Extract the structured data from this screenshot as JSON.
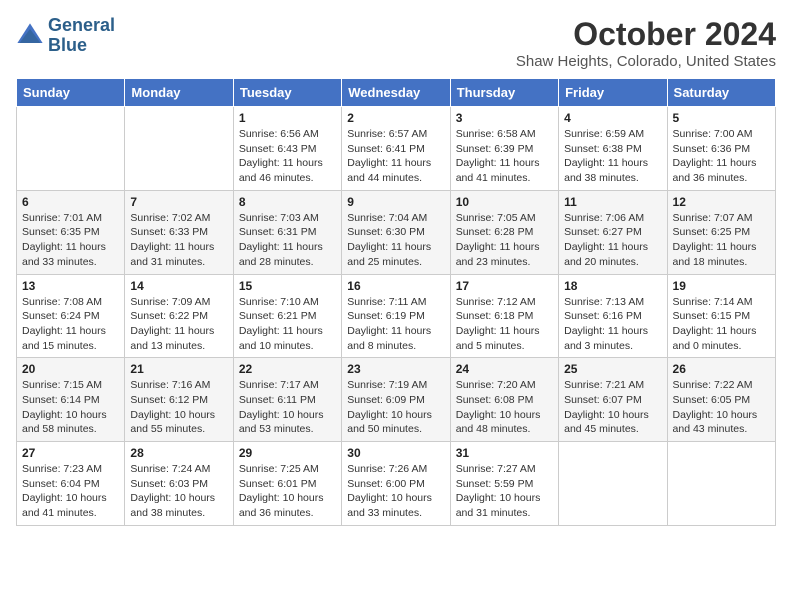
{
  "header": {
    "logo_line1": "General",
    "logo_line2": "Blue",
    "month_title": "October 2024",
    "location": "Shaw Heights, Colorado, United States"
  },
  "weekdays": [
    "Sunday",
    "Monday",
    "Tuesday",
    "Wednesday",
    "Thursday",
    "Friday",
    "Saturday"
  ],
  "weeks": [
    [
      {
        "day": "",
        "sunrise": "",
        "sunset": "",
        "daylight": ""
      },
      {
        "day": "",
        "sunrise": "",
        "sunset": "",
        "daylight": ""
      },
      {
        "day": "1",
        "sunrise": "Sunrise: 6:56 AM",
        "sunset": "Sunset: 6:43 PM",
        "daylight": "Daylight: 11 hours and 46 minutes."
      },
      {
        "day": "2",
        "sunrise": "Sunrise: 6:57 AM",
        "sunset": "Sunset: 6:41 PM",
        "daylight": "Daylight: 11 hours and 44 minutes."
      },
      {
        "day": "3",
        "sunrise": "Sunrise: 6:58 AM",
        "sunset": "Sunset: 6:39 PM",
        "daylight": "Daylight: 11 hours and 41 minutes."
      },
      {
        "day": "4",
        "sunrise": "Sunrise: 6:59 AM",
        "sunset": "Sunset: 6:38 PM",
        "daylight": "Daylight: 11 hours and 38 minutes."
      },
      {
        "day": "5",
        "sunrise": "Sunrise: 7:00 AM",
        "sunset": "Sunset: 6:36 PM",
        "daylight": "Daylight: 11 hours and 36 minutes."
      }
    ],
    [
      {
        "day": "6",
        "sunrise": "Sunrise: 7:01 AM",
        "sunset": "Sunset: 6:35 PM",
        "daylight": "Daylight: 11 hours and 33 minutes."
      },
      {
        "day": "7",
        "sunrise": "Sunrise: 7:02 AM",
        "sunset": "Sunset: 6:33 PM",
        "daylight": "Daylight: 11 hours and 31 minutes."
      },
      {
        "day": "8",
        "sunrise": "Sunrise: 7:03 AM",
        "sunset": "Sunset: 6:31 PM",
        "daylight": "Daylight: 11 hours and 28 minutes."
      },
      {
        "day": "9",
        "sunrise": "Sunrise: 7:04 AM",
        "sunset": "Sunset: 6:30 PM",
        "daylight": "Daylight: 11 hours and 25 minutes."
      },
      {
        "day": "10",
        "sunrise": "Sunrise: 7:05 AM",
        "sunset": "Sunset: 6:28 PM",
        "daylight": "Daylight: 11 hours and 23 minutes."
      },
      {
        "day": "11",
        "sunrise": "Sunrise: 7:06 AM",
        "sunset": "Sunset: 6:27 PM",
        "daylight": "Daylight: 11 hours and 20 minutes."
      },
      {
        "day": "12",
        "sunrise": "Sunrise: 7:07 AM",
        "sunset": "Sunset: 6:25 PM",
        "daylight": "Daylight: 11 hours and 18 minutes."
      }
    ],
    [
      {
        "day": "13",
        "sunrise": "Sunrise: 7:08 AM",
        "sunset": "Sunset: 6:24 PM",
        "daylight": "Daylight: 11 hours and 15 minutes."
      },
      {
        "day": "14",
        "sunrise": "Sunrise: 7:09 AM",
        "sunset": "Sunset: 6:22 PM",
        "daylight": "Daylight: 11 hours and 13 minutes."
      },
      {
        "day": "15",
        "sunrise": "Sunrise: 7:10 AM",
        "sunset": "Sunset: 6:21 PM",
        "daylight": "Daylight: 11 hours and 10 minutes."
      },
      {
        "day": "16",
        "sunrise": "Sunrise: 7:11 AM",
        "sunset": "Sunset: 6:19 PM",
        "daylight": "Daylight: 11 hours and 8 minutes."
      },
      {
        "day": "17",
        "sunrise": "Sunrise: 7:12 AM",
        "sunset": "Sunset: 6:18 PM",
        "daylight": "Daylight: 11 hours and 5 minutes."
      },
      {
        "day": "18",
        "sunrise": "Sunrise: 7:13 AM",
        "sunset": "Sunset: 6:16 PM",
        "daylight": "Daylight: 11 hours and 3 minutes."
      },
      {
        "day": "19",
        "sunrise": "Sunrise: 7:14 AM",
        "sunset": "Sunset: 6:15 PM",
        "daylight": "Daylight: 11 hours and 0 minutes."
      }
    ],
    [
      {
        "day": "20",
        "sunrise": "Sunrise: 7:15 AM",
        "sunset": "Sunset: 6:14 PM",
        "daylight": "Daylight: 10 hours and 58 minutes."
      },
      {
        "day": "21",
        "sunrise": "Sunrise: 7:16 AM",
        "sunset": "Sunset: 6:12 PM",
        "daylight": "Daylight: 10 hours and 55 minutes."
      },
      {
        "day": "22",
        "sunrise": "Sunrise: 7:17 AM",
        "sunset": "Sunset: 6:11 PM",
        "daylight": "Daylight: 10 hours and 53 minutes."
      },
      {
        "day": "23",
        "sunrise": "Sunrise: 7:19 AM",
        "sunset": "Sunset: 6:09 PM",
        "daylight": "Daylight: 10 hours and 50 minutes."
      },
      {
        "day": "24",
        "sunrise": "Sunrise: 7:20 AM",
        "sunset": "Sunset: 6:08 PM",
        "daylight": "Daylight: 10 hours and 48 minutes."
      },
      {
        "day": "25",
        "sunrise": "Sunrise: 7:21 AM",
        "sunset": "Sunset: 6:07 PM",
        "daylight": "Daylight: 10 hours and 45 minutes."
      },
      {
        "day": "26",
        "sunrise": "Sunrise: 7:22 AM",
        "sunset": "Sunset: 6:05 PM",
        "daylight": "Daylight: 10 hours and 43 minutes."
      }
    ],
    [
      {
        "day": "27",
        "sunrise": "Sunrise: 7:23 AM",
        "sunset": "Sunset: 6:04 PM",
        "daylight": "Daylight: 10 hours and 41 minutes."
      },
      {
        "day": "28",
        "sunrise": "Sunrise: 7:24 AM",
        "sunset": "Sunset: 6:03 PM",
        "daylight": "Daylight: 10 hours and 38 minutes."
      },
      {
        "day": "29",
        "sunrise": "Sunrise: 7:25 AM",
        "sunset": "Sunset: 6:01 PM",
        "daylight": "Daylight: 10 hours and 36 minutes."
      },
      {
        "day": "30",
        "sunrise": "Sunrise: 7:26 AM",
        "sunset": "Sunset: 6:00 PM",
        "daylight": "Daylight: 10 hours and 33 minutes."
      },
      {
        "day": "31",
        "sunrise": "Sunrise: 7:27 AM",
        "sunset": "Sunset: 5:59 PM",
        "daylight": "Daylight: 10 hours and 31 minutes."
      },
      {
        "day": "",
        "sunrise": "",
        "sunset": "",
        "daylight": ""
      },
      {
        "day": "",
        "sunrise": "",
        "sunset": "",
        "daylight": ""
      }
    ]
  ]
}
